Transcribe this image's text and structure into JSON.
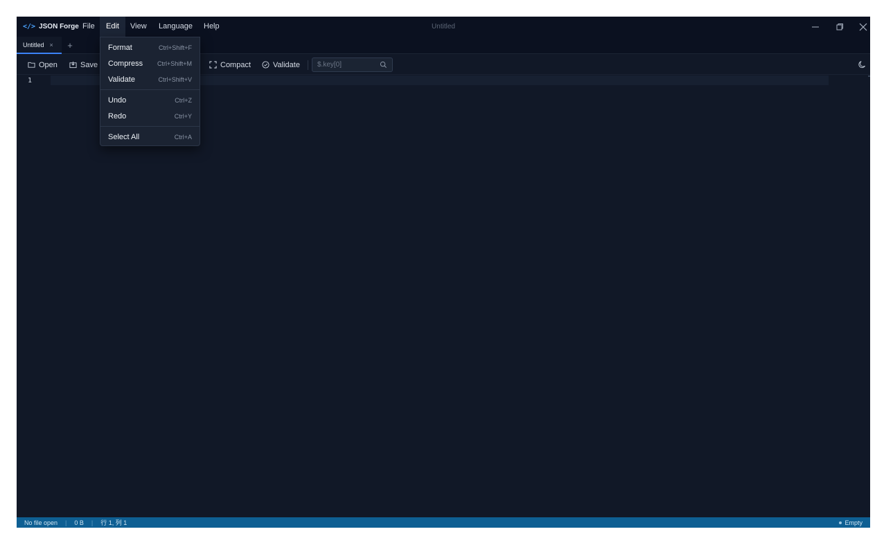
{
  "app": {
    "logo_glyph": "</>",
    "name": "JSON Forge",
    "window_title": "Untitled"
  },
  "menubar": {
    "items": [
      {
        "label": "File"
      },
      {
        "label": "Edit"
      },
      {
        "label": "View"
      },
      {
        "label": "Language"
      },
      {
        "label": "Help"
      }
    ],
    "active": "Edit"
  },
  "window_controls": [
    "minimize-icon",
    "maximize-icon",
    "close-icon"
  ],
  "tabs": {
    "items": [
      {
        "label": "Untitled",
        "close": "×"
      }
    ],
    "new_tab": "+"
  },
  "toolbar": {
    "open_label": "Open",
    "save_label": "Save",
    "compact_label": "Compact",
    "validate_label": "Validate",
    "path_placeholder": "$.key[0]"
  },
  "edit_menu": {
    "groups": [
      [
        {
          "label": "Format",
          "shortcut": "Ctrl+Shift+F"
        },
        {
          "label": "Compress",
          "shortcut": "Ctrl+Shift+M"
        },
        {
          "label": "Validate",
          "shortcut": "Ctrl+Shift+V"
        }
      ],
      [
        {
          "label": "Undo",
          "shortcut": "Ctrl+Z"
        },
        {
          "label": "Redo",
          "shortcut": "Ctrl+Y"
        }
      ],
      [
        {
          "label": "Select All",
          "shortcut": "Ctrl+A"
        }
      ]
    ]
  },
  "editor": {
    "line_numbers": [
      "1"
    ],
    "content": ""
  },
  "statusbar": {
    "file": "No file open",
    "size": "0 B",
    "position": "行 1, 列 1",
    "state": "Empty"
  },
  "colors": {
    "background": "#111827",
    "titlebar": "#0b1120",
    "accent": "#3b82f6",
    "statusbar": "#0e5f93"
  }
}
